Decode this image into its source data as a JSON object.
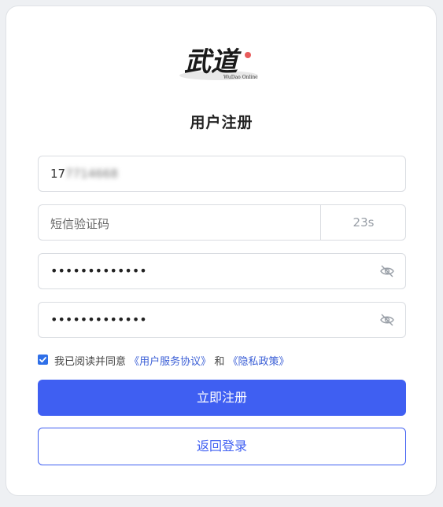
{
  "logo": {
    "glyphs": "武道",
    "subtitle": "WuDao Online",
    "seal_color": "#e85c5c"
  },
  "title": "用户注册",
  "phone": {
    "prefix": "17",
    "hidden_part": "7714668"
  },
  "sms": {
    "placeholder": "短信验证码",
    "countdown": "23s"
  },
  "password": {
    "masked": "•••••••••••••",
    "eye_icon": "eye-off-icon"
  },
  "confirm_password": {
    "masked": "•••••••••••••",
    "eye_icon": "eye-off-icon"
  },
  "agreement": {
    "checked": true,
    "prefix": "我已阅读并同意",
    "terms_link": "《用户服务协议》",
    "and": "和",
    "privacy_link": "《隐私政策》"
  },
  "buttons": {
    "register": "立即注册",
    "back_to_login": "返回登录"
  },
  "colors": {
    "primary": "#3f5ff2",
    "link": "#3b5fd6",
    "checkbox": "#2f6fe8"
  }
}
